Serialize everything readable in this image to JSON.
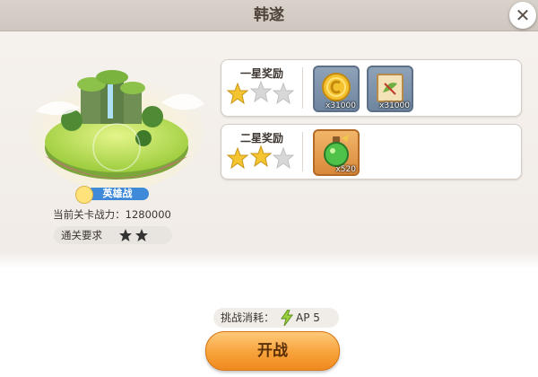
{
  "stage_name": "韩遂",
  "battle_mode": "英雄战",
  "power": {
    "label": "当前关卡战力：",
    "value": "1280000"
  },
  "pass_requirement": {
    "label": "通关要求",
    "stars": 2
  },
  "rewards": [
    {
      "tier_label": "一星奖励",
      "stars_earned": 1,
      "stars_total": 3,
      "items": [
        {
          "icon": "gold-coin-icon",
          "quantity": "x31000"
        },
        {
          "icon": "scroll-icon",
          "quantity": "x31000"
        }
      ]
    },
    {
      "tier_label": "二星奖励",
      "stars_earned": 2,
      "stars_total": 3,
      "items": [
        {
          "icon": "green-potion-icon",
          "quantity": "x520"
        }
      ]
    }
  ],
  "cost": {
    "label": "挑战消耗：",
    "resource_icon": "lightning-icon",
    "value": "AP 5"
  },
  "start_button": "开战",
  "colors": {
    "star_gold": "#f5c431",
    "star_empty": "#d8d8d8",
    "button_orange": "#f7a23a",
    "badge_blue": "#3f8ad8"
  }
}
